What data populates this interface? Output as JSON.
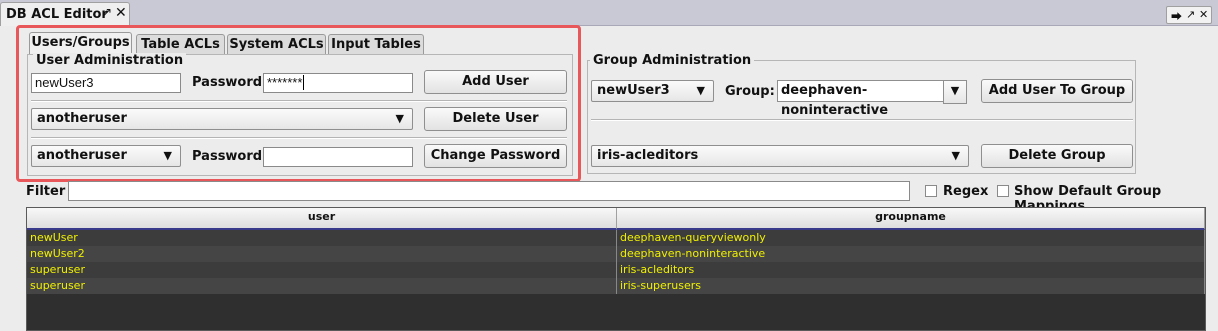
{
  "window": {
    "title": "DB ACL Editor",
    "controls": [
      "pin-icon",
      "close-icon"
    ]
  },
  "tabs": [
    "Users/Groups",
    "Table ACLs",
    "System ACLs",
    "Input Tables"
  ],
  "user_admin": {
    "title": "User Administration",
    "new_user_value": "newUser3",
    "password_label": "Password:",
    "password_value": "*******",
    "add_user_label": "Add User",
    "delete_user_select": "anotheruser",
    "delete_user_label": "Delete User",
    "change_pw_user_select": "anotheruser",
    "change_pw_password_label": "Password:",
    "change_pw_value": "",
    "change_password_label": "Change Password"
  },
  "group_admin": {
    "title": "Group Administration",
    "user_select": "newUser3",
    "group_label": "Group:",
    "group_select": "deephaven-noninteractive",
    "add_user_to_group_label": "Add User To Group",
    "delete_group_select": "iris-acleditors",
    "delete_group_label": "Delete Group"
  },
  "filter": {
    "label": "Filter",
    "value": "",
    "regex_label": "Regex",
    "regex_checked": false,
    "show_default_label": "Show Default Group Mappings",
    "show_default_checked": false
  },
  "table": {
    "columns": [
      "user",
      "groupname"
    ],
    "rows": [
      [
        "newUser",
        "deephaven-queryviewonly"
      ],
      [
        "newUser2",
        "deephaven-noninteractive"
      ],
      [
        "superuser",
        "iris-acleditors"
      ],
      [
        "superuser",
        "iris-superusers"
      ]
    ]
  },
  "colors": {
    "highlight": "#e8585a",
    "grid_text": "#f0f000",
    "grid_bg": "#2f2f2f"
  }
}
